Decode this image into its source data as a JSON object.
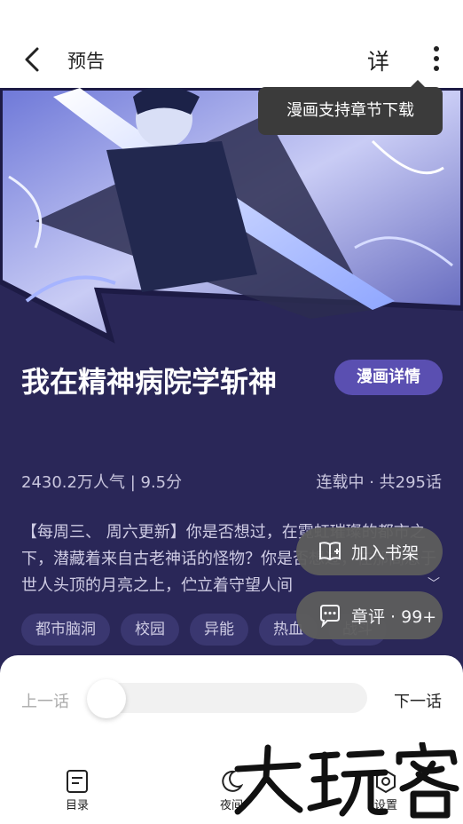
{
  "header": {
    "title": "预告",
    "detail_label": "详"
  },
  "tooltip": {
    "text": "漫画支持章节下载"
  },
  "comic": {
    "title": "我在精神病院学斩神",
    "detail_button": "漫画详情",
    "popularity_rating": "2430.2万人气 | 9.5分",
    "status": "连载中 · 共295话",
    "description": "【每周三、 周六更新】你是否想过，在霓虹璀璨的都市之下，潜藏着来自古老神话的怪物？你是否想过，在那高悬于世人头顶的月亮之上，伫立着守望人间",
    "tags": [
      "都市脑洞",
      "校园",
      "异能",
      "热血",
      "战斗"
    ]
  },
  "floating": {
    "add_shelf": "加入书架",
    "comment": "章评 · 99+"
  },
  "reader_controls": {
    "prev_chapter": "上一话",
    "next_chapter": "下一话",
    "progress": 0
  },
  "bottom_nav": [
    {
      "label": "目录",
      "icon": "list-icon"
    },
    {
      "label": "夜间",
      "icon": "moon-icon"
    },
    {
      "label": "设置",
      "icon": "settings-icon"
    }
  ],
  "watermark": "大玩客",
  "colors": {
    "panel_bg": "#2a2758",
    "accent_button": "#5a4fb1",
    "tooltip_bg": "#3b3b3b",
    "float_button_bg": "#5d5d5d"
  }
}
